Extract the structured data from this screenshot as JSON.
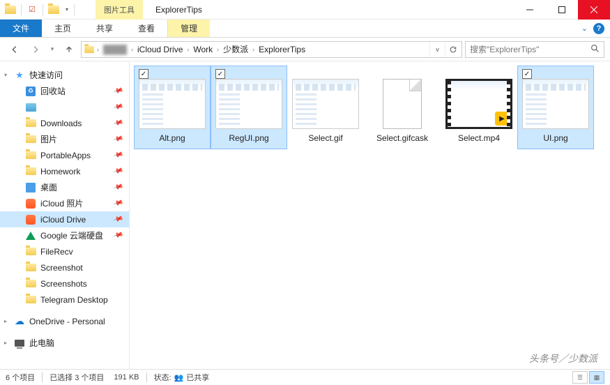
{
  "window": {
    "contextual_tab_group": "图片工具",
    "title": "ExplorerTips"
  },
  "ribbon": {
    "tabs": {
      "file": "文件",
      "home": "主页",
      "share": "共享",
      "view": "查看",
      "manage": "管理"
    }
  },
  "breadcrumbs": {
    "hidden_user": "████",
    "items": [
      "iCloud Drive",
      "Work",
      "少数派",
      "ExplorerTips"
    ]
  },
  "search": {
    "placeholder": "搜索\"ExplorerTips\""
  },
  "sidebar": {
    "quick_access": "快速访问",
    "items": [
      {
        "label": "回收站",
        "icon": "recycle",
        "pinned": true
      },
      {
        "label": "",
        "icon": "pic",
        "pinned": true
      },
      {
        "label": "Downloads",
        "icon": "folder",
        "pinned": true
      },
      {
        "label": "图片",
        "icon": "folder",
        "pinned": true
      },
      {
        "label": "PortableApps",
        "icon": "folder",
        "pinned": true
      },
      {
        "label": "Homework",
        "icon": "folder",
        "pinned": true
      },
      {
        "label": "桌面",
        "icon": "desk",
        "pinned": true
      },
      {
        "label": "iCloud 照片",
        "icon": "icloud",
        "pinned": true
      },
      {
        "label": "iCloud Drive",
        "icon": "icloud",
        "pinned": true,
        "selected": true
      },
      {
        "label": "Google 云端硬盘",
        "icon": "gdrive",
        "pinned": true
      },
      {
        "label": "FileRecv",
        "icon": "folder",
        "pinned": false
      },
      {
        "label": "Screenshot",
        "icon": "folder",
        "pinned": false
      },
      {
        "label": "Screenshots",
        "icon": "folder",
        "pinned": false
      },
      {
        "label": "Telegram Desktop",
        "icon": "folder",
        "pinned": false
      }
    ],
    "onedrive": "OneDrive - Personal",
    "this_pc": "此电脑"
  },
  "files": [
    {
      "name": "Alt.png",
      "type": "screenshot",
      "selected": true
    },
    {
      "name": "RegUI.png",
      "type": "screenshot",
      "selected": true
    },
    {
      "name": "Select.gif",
      "type": "screenshot",
      "selected": false
    },
    {
      "name": "Select.gifcask",
      "type": "blankdoc",
      "selected": false
    },
    {
      "name": "Select.mp4",
      "type": "video",
      "selected": false
    },
    {
      "name": "UI.png",
      "type": "screenshot",
      "selected": true
    }
  ],
  "status": {
    "item_count": "6 个项目",
    "selected": "已选择 3 个项目",
    "size": "191 KB",
    "state_label": "状态:",
    "state_value": "已共享"
  },
  "watermark": "头条号／少数派"
}
